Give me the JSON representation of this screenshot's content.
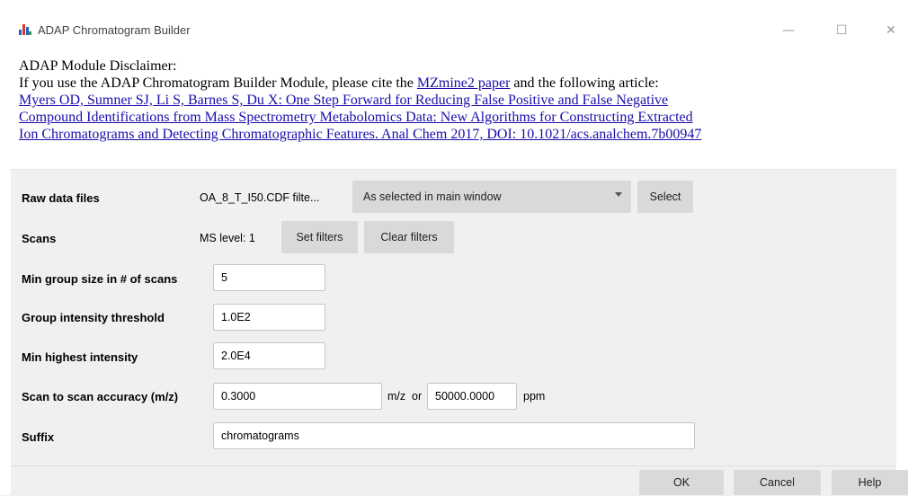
{
  "window": {
    "title": "ADAP Chromatogram Builder",
    "minimize_symbol": "—",
    "maximize_symbol": "☐",
    "close_symbol": "✕"
  },
  "disclaimer": {
    "heading": "ADAP Module Disclaimer:",
    "line_prefix": "If you use the ADAP Chromatogram Builder Module, please cite the ",
    "mzmine_link": "MZmine2 paper",
    "line_suffix": " and the following article:",
    "article_line1": "Myers OD, Sumner SJ, Li S, Barnes S, Du X: One Step Forward for Reducing False Positive and False Negative",
    "article_line2": "Compound Identifications from Mass Spectrometry Metabolomics Data: New Algorithms for Constructing Extracted",
    "article_line3": "Ion Chromatograms and Detecting Chromatographic Features. Anal Chem 2017, DOI: 10.1021/acs.analchem.7b00947"
  },
  "form": {
    "raw_data_files": {
      "label": "Raw data files",
      "files_text": "OA_8_T_I50.CDF filte...",
      "selection": "As selected in main window",
      "select_button": "Select"
    },
    "scans": {
      "label": "Scans",
      "ms_level": "MS level: 1",
      "set_filters": "Set filters",
      "clear_filters": "Clear filters"
    },
    "min_group_size": {
      "label": "Min group size in # of scans",
      "value": "5"
    },
    "group_intensity_threshold": {
      "label": "Group intensity threshold",
      "value": "1.0E2"
    },
    "min_highest_intensity": {
      "label": "Min highest intensity",
      "value": "2.0E4"
    },
    "scan_accuracy": {
      "label": "Scan to scan accuracy (m/z)",
      "mz_value": "0.3000",
      "mz_unit": "m/z",
      "or_text": "or",
      "ppm_value": "50000.0000",
      "ppm_unit": "ppm"
    },
    "suffix": {
      "label": "Suffix",
      "value": "chromatograms"
    }
  },
  "buttons": {
    "ok": "OK",
    "cancel": "Cancel",
    "help": "Help"
  },
  "icons": {
    "app": "chromatogram-app-icon",
    "dropdown": "chevron-down-icon"
  },
  "colors": {
    "link": "#1a0dab",
    "button": "#d9d9d9",
    "form_bg": "#f0f0f0"
  }
}
